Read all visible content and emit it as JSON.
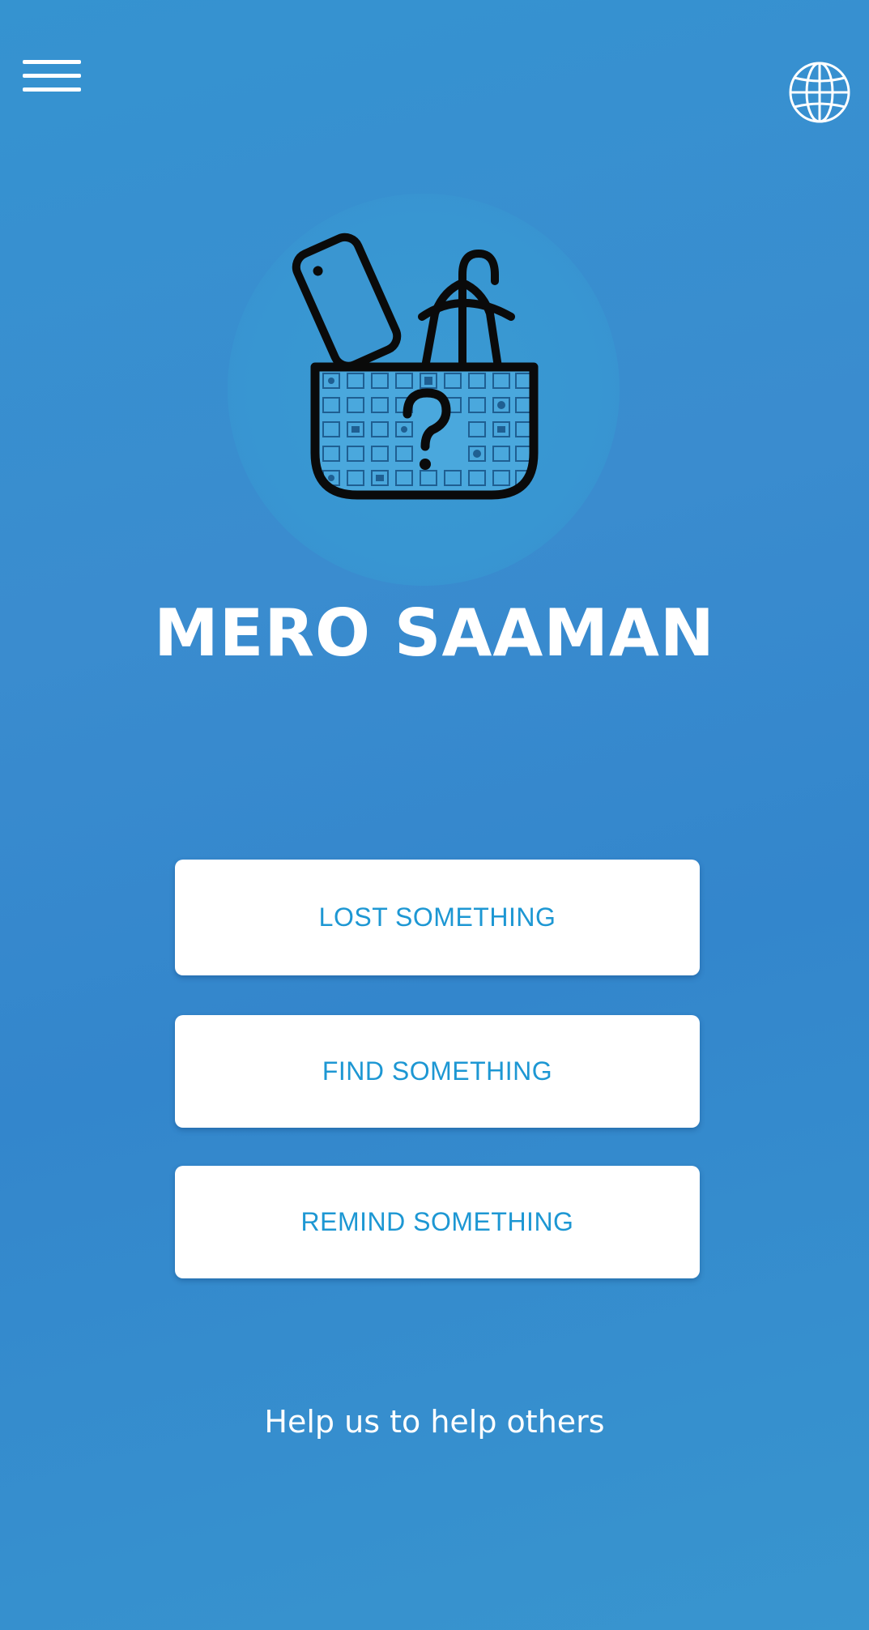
{
  "header": {
    "menu_icon": "hamburger-menu-icon",
    "language_icon": "globe-icon"
  },
  "logo": {
    "icon": "basket-with-phone-umbrella-question-icon"
  },
  "app": {
    "title": "MERO SAAMAN"
  },
  "actions": {
    "lost_label": "LOST SOMETHING",
    "find_label": "FIND SOMETHING",
    "remind_label": "REMIND SOMETHING"
  },
  "footer": {
    "help_text": "Help us to help others"
  },
  "colors": {
    "background": "#3a8ccf",
    "button_background": "#ffffff",
    "button_text": "#1d97d3",
    "title_text": "#ffffff"
  }
}
